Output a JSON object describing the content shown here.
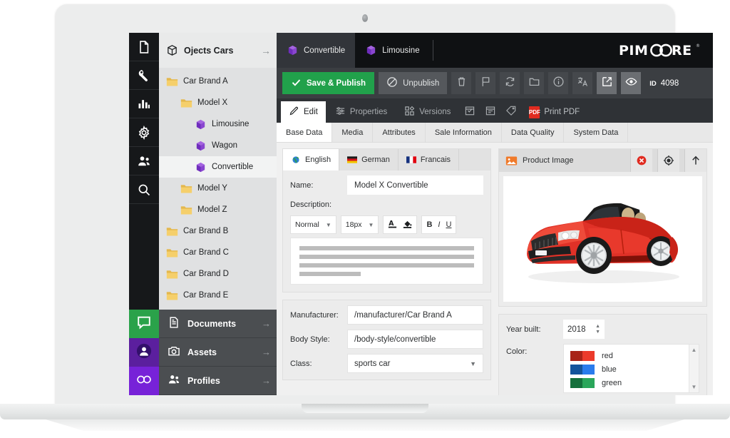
{
  "rail": {
    "icons": [
      {
        "name": "document-icon"
      },
      {
        "name": "wrench-icon"
      },
      {
        "name": "bar-chart-icon"
      },
      {
        "name": "gear-icon"
      },
      {
        "name": "users-icon"
      },
      {
        "name": "search-icon"
      }
    ],
    "bottom": [
      {
        "name": "chat-icon",
        "color": "#2aa24a"
      },
      {
        "name": "user-circle-icon",
        "color": "#5b1f9e"
      },
      {
        "name": "infinity-icon",
        "color": "#7722d8"
      }
    ]
  },
  "tree": {
    "header": {
      "icon": "cube-outline-icon",
      "label": "Ojects Cars",
      "arrow": "→"
    },
    "nodes": [
      {
        "label": "Car Brand A",
        "icon": "folder-icon",
        "indent": 0,
        "selected": false
      },
      {
        "label": "Model X",
        "icon": "folder-icon",
        "indent": 1,
        "selected": false
      },
      {
        "label": "Limousine",
        "icon": "object-cube-icon",
        "indent": 2,
        "selected": false
      },
      {
        "label": "Wagon",
        "icon": "object-cube-icon",
        "indent": 2,
        "selected": false
      },
      {
        "label": "Convertible",
        "icon": "object-cube-icon",
        "indent": 2,
        "selected": true
      },
      {
        "label": "Model Y",
        "icon": "folder-icon",
        "indent": 1,
        "selected": false
      },
      {
        "label": "Model Z",
        "icon": "folder-icon",
        "indent": 1,
        "selected": false
      },
      {
        "label": "Car Brand B",
        "icon": "folder-icon",
        "indent": 0,
        "selected": false
      },
      {
        "label": "Car Brand C",
        "icon": "folder-icon",
        "indent": 0,
        "selected": false
      },
      {
        "label": "Car Brand D",
        "icon": "folder-icon",
        "indent": 0,
        "selected": false
      },
      {
        "label": "Car Brand E",
        "icon": "folder-icon",
        "indent": 0,
        "selected": false
      }
    ],
    "nav": [
      {
        "label": "Documents",
        "icon": "document-icon",
        "arrow": "→"
      },
      {
        "label": "Assets",
        "icon": "camera-icon",
        "arrow": "→"
      },
      {
        "label": "Profiles",
        "icon": "people-icon",
        "arrow": "→"
      }
    ]
  },
  "topbar": {
    "tabs": [
      {
        "label": "Convertible",
        "icon": "object-cube-icon",
        "active": true
      },
      {
        "label": "Limousine",
        "icon": "object-cube-icon",
        "active": false
      }
    ],
    "brand": "PIMCORE",
    "brand_reg": "®"
  },
  "actionbar": {
    "save_label": "Save & Publish",
    "unpublish_label": "Unpublish",
    "icons": [
      {
        "name": "trash-icon"
      },
      {
        "name": "flag-icon"
      },
      {
        "name": "reload-icon"
      },
      {
        "name": "folder-icon"
      },
      {
        "name": "info-icon"
      },
      {
        "name": "translate-icon"
      }
    ],
    "icons_light": [
      {
        "name": "open-external-icon"
      },
      {
        "name": "eye-icon"
      }
    ],
    "id_key": "ID",
    "id_value": "4098"
  },
  "subbar": {
    "tabs": [
      {
        "label": "Edit",
        "icon": "pencil-icon",
        "active": true
      },
      {
        "label": "Properties",
        "icon": "sliders-icon",
        "active": false
      },
      {
        "label": "Versions",
        "icon": "grid-icon",
        "active": false
      }
    ],
    "icons": [
      {
        "name": "calendar-check-icon"
      },
      {
        "name": "calendar-list-icon"
      },
      {
        "name": "tag-icon"
      }
    ],
    "pdf_label": "Print PDF",
    "pdf_glyph": "PDF"
  },
  "datatabs": [
    {
      "label": "Base Data",
      "active": true
    },
    {
      "label": "Media",
      "active": false
    },
    {
      "label": "Attributes",
      "active": false
    },
    {
      "label": "Sale Information",
      "active": false
    },
    {
      "label": "Data Quality",
      "active": false
    },
    {
      "label": "System Data",
      "active": false
    }
  ],
  "langtabs": [
    {
      "label": "English",
      "flag": "globe-icon",
      "active": true
    },
    {
      "label": "German",
      "flag": "flag-de-icon",
      "active": false
    },
    {
      "label": "Francais",
      "flag": "flag-fr-icon",
      "active": false
    }
  ],
  "form": {
    "name_label": "Name:",
    "name_value": "Model X Convertible",
    "description_label": "Description:",
    "manufacturer_label": "Manufacturer:",
    "manufacturer_value": "/manufacturer/Car Brand A",
    "bodystyle_label": "Body Style:",
    "bodystyle_value": "/body-style/convertible",
    "class_label": "Class:",
    "class_value": "sports car"
  },
  "rte": {
    "style_value": "Normal",
    "size_value": "18px",
    "color_icon": "text-color-icon",
    "highlight_icon": "fill-color-icon",
    "bold": "B",
    "italic": "I",
    "underline": "U"
  },
  "imagecard": {
    "title": "Product Image",
    "icon": "image-icon",
    "buttons": [
      {
        "name": "remove-image-button",
        "glyph": "✕",
        "color": "#e02b20"
      },
      {
        "name": "target-image-button",
        "glyph": "◎",
        "color": "#2d2f31"
      },
      {
        "name": "upload-image-button",
        "glyph": "↑",
        "color": "#2d2f31"
      }
    ],
    "image_alt": "red-convertible-car"
  },
  "right_form": {
    "year_label": "Year built:",
    "year_value": "2018",
    "color_label": "Color:",
    "colors": [
      {
        "name": "red",
        "dark": "#a82318",
        "light": "#eb3a2b"
      },
      {
        "name": "blue",
        "dark": "#14549c",
        "light": "#2a7cec"
      },
      {
        "name": "green",
        "dark": "#15703c",
        "light": "#2aa65a"
      }
    ]
  }
}
